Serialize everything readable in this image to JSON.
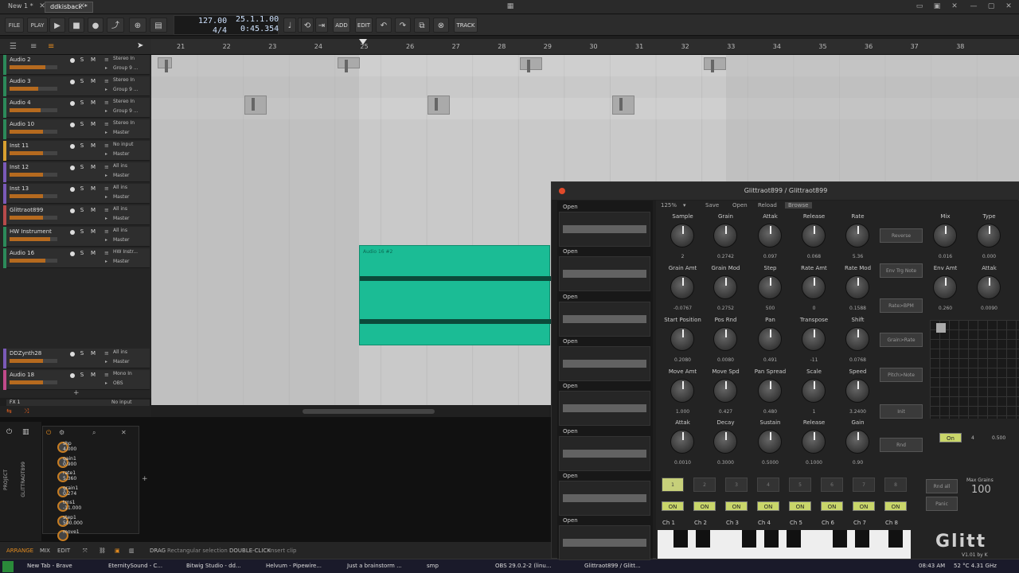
{
  "window": {
    "tabs": [
      {
        "label": "New 1 *"
      },
      {
        "label": "ddkisback *"
      }
    ],
    "controls": [
      "—",
      "▢",
      "✕"
    ]
  },
  "toolbar": {
    "file": "FILE",
    "play": "PLAY",
    "add": "ADD",
    "edit": "EDIT",
    "track": "TRACK",
    "tempo": "127.00",
    "sig": "4/4",
    "pos": "25.1.1.00",
    "time": "0:45.354"
  },
  "ruler": [
    "21",
    "22",
    "23",
    "24",
    "25",
    "26",
    "27",
    "28",
    "29",
    "30",
    "31",
    "32",
    "33",
    "34",
    "35",
    "36",
    "37",
    "38"
  ],
  "tracks": [
    {
      "name": "Audio 2",
      "in": "Stereo In",
      "out": "Group 9 ...",
      "color": "#2c8a5a",
      "fill": 0.75
    },
    {
      "name": "Audio 3",
      "in": "Stereo In",
      "out": "Group 9 ...",
      "color": "#2c8a5a",
      "fill": 0.6
    },
    {
      "name": "Audio 4",
      "in": "Stereo In",
      "out": "Group 9 ...",
      "color": "#2c8a5a",
      "fill": 0.65
    },
    {
      "name": "Audio 10",
      "in": "Stereo In",
      "out": "Master",
      "color": "#2c8a5a",
      "fill": 0.7
    },
    {
      "name": "Inst 11",
      "in": "No input",
      "out": "Master",
      "color": "#d8a030",
      "fill": 0.7
    },
    {
      "name": "Inst 12",
      "in": "All ins",
      "out": "Master",
      "color": "#7a5ab8",
      "fill": 0.7
    },
    {
      "name": "Inst 13",
      "in": "All ins",
      "out": "Master",
      "color": "#7a5ab8",
      "fill": 0.7
    },
    {
      "name": "Glittraot899",
      "in": "All ins",
      "out": "Master",
      "color": "#b84a4a",
      "fill": 0.7
    },
    {
      "name": "HW Instrument",
      "in": "All ins",
      "out": "Master",
      "color": "#2c8a5a",
      "fill": 0.85
    },
    {
      "name": "Audio 16",
      "in": "HW Instr...",
      "out": "Master",
      "color": "#2c8a5a",
      "fill": 0.75
    },
    {
      "name": "DDZynth28",
      "in": "All ins",
      "out": "Master",
      "color": "#7a5ab8",
      "fill": 0.7
    },
    {
      "name": "Audio 18",
      "in": "Mono In",
      "out": "OBS",
      "color": "#c04a8a",
      "fill": 0.7
    }
  ],
  "track_extra": {
    "fx": "FX 1",
    "fx_in": "No input",
    "add": "+"
  },
  "clip": {
    "label": "Audio 16 #2"
  },
  "params": [
    {
      "name": "shp",
      "value": "4.000"
    },
    {
      "name": "gain1",
      "value": "0.900"
    },
    {
      "name": "rate1",
      "value": "5.360"
    },
    {
      "name": "grain1",
      "value": "0.274"
    },
    {
      "name": "trns1",
      "value": "-11.000"
    },
    {
      "name": "step1",
      "value": "500.000"
    },
    {
      "name": "move1",
      "value": ""
    }
  ],
  "device_labels": {
    "project": "PROJECT",
    "device": "GLITTRAOT899"
  },
  "statusbar": {
    "arrange": "ARRANGE",
    "mix": "MIX",
    "edit": "EDIT",
    "drag": "DRAG",
    "drag_desc": "Rectangular selection",
    "dblclick": "DOUBLE-CLICK",
    "dbl_desc": "Insert clip"
  },
  "taskbar": [
    {
      "label": "New Tab - Brave"
    },
    {
      "label": "EternitySound - C..."
    },
    {
      "label": "Bitwig Studio - dd..."
    },
    {
      "label": "Helvum - Pipewire..."
    },
    {
      "label": "Just a brainstorm ..."
    },
    {
      "label": "smp"
    },
    {
      "label": "OBS 29.0.2-2 (linu..."
    },
    {
      "label": "Glittraot899 / Glitt..."
    }
  ],
  "clock": "08:43 AM",
  "cpu": "52 °C 4.31 GHz",
  "plugin": {
    "title": "Glittraot899 / Glittraot899",
    "zoom": "125%",
    "save": "Save",
    "open": "Open",
    "reload": "Reload",
    "browse": "Browse",
    "samples_open": "Open",
    "rows": [
      [
        {
          "label": "Sample",
          "value": "2"
        },
        {
          "label": "Grain",
          "value": "0.2742"
        },
        {
          "label": "Attak",
          "value": "0.097"
        },
        {
          "label": "Release",
          "value": "0.068"
        },
        {
          "label": "Rate",
          "value": "5.36"
        }
      ],
      [
        {
          "label": "Grain Amt",
          "value": "-0.0767"
        },
        {
          "label": "Grain Mod",
          "value": "0.2752"
        },
        {
          "label": "Step",
          "value": "500"
        },
        {
          "label": "Rate Amt",
          "value": "0"
        },
        {
          "label": "Rate Mod",
          "value": "0.1588"
        }
      ],
      [
        {
          "label": "Start Position",
          "value": "0.2080"
        },
        {
          "label": "Pos Rnd",
          "value": "0.0080"
        },
        {
          "label": "Pan",
          "value": "0.491"
        },
        {
          "label": "Transpose",
          "value": "-11"
        },
        {
          "label": "Shift",
          "value": "0.0768"
        }
      ],
      [
        {
          "label": "Move Amt",
          "value": "1.000"
        },
        {
          "label": "Move Spd",
          "value": "0.427"
        },
        {
          "label": "Pan Spread",
          "value": "0.480"
        },
        {
          "label": "Scale",
          "value": "1"
        },
        {
          "label": "Speed",
          "value": "3.2400"
        }
      ],
      [
        {
          "label": "Attak",
          "value": "0.0010"
        },
        {
          "label": "Decay",
          "value": "0.3000"
        },
        {
          "label": "Sustain",
          "value": "0.5000"
        },
        {
          "label": "Release",
          "value": "0.1000"
        },
        {
          "label": "Gain",
          "value": "0.90"
        }
      ]
    ],
    "right": [
      {
        "label": "Mix",
        "value": "0.016"
      },
      {
        "label": "Type",
        "value": "0.000"
      },
      {
        "label": "Env Amt",
        "value": "0.260"
      },
      {
        "label": "Attak",
        "value": "0.0090"
      }
    ],
    "side_buttons": [
      "Reverse",
      "Env Trg Note",
      "Rate>BPM",
      "Grain>Rate",
      "Pitch>Note",
      "Init",
      "Rnd"
    ],
    "pads": [
      "1",
      "2",
      "3",
      "4",
      "5",
      "6",
      "7",
      "8"
    ],
    "on": "ON",
    "channels": [
      "Ch  1",
      "Ch  2",
      "Ch  3",
      "Ch  4",
      "Ch  5",
      "Ch  6",
      "Ch  7",
      "Ch  8"
    ],
    "rnd_all": "Rnd all",
    "panic": "Panic",
    "max_grains_label": "Max Grains",
    "max_grains": "100",
    "seq_on": "On",
    "seq_steps": "4",
    "seq_rate": "0.500",
    "version": "V1.01 by K",
    "logo": "Glitt"
  }
}
